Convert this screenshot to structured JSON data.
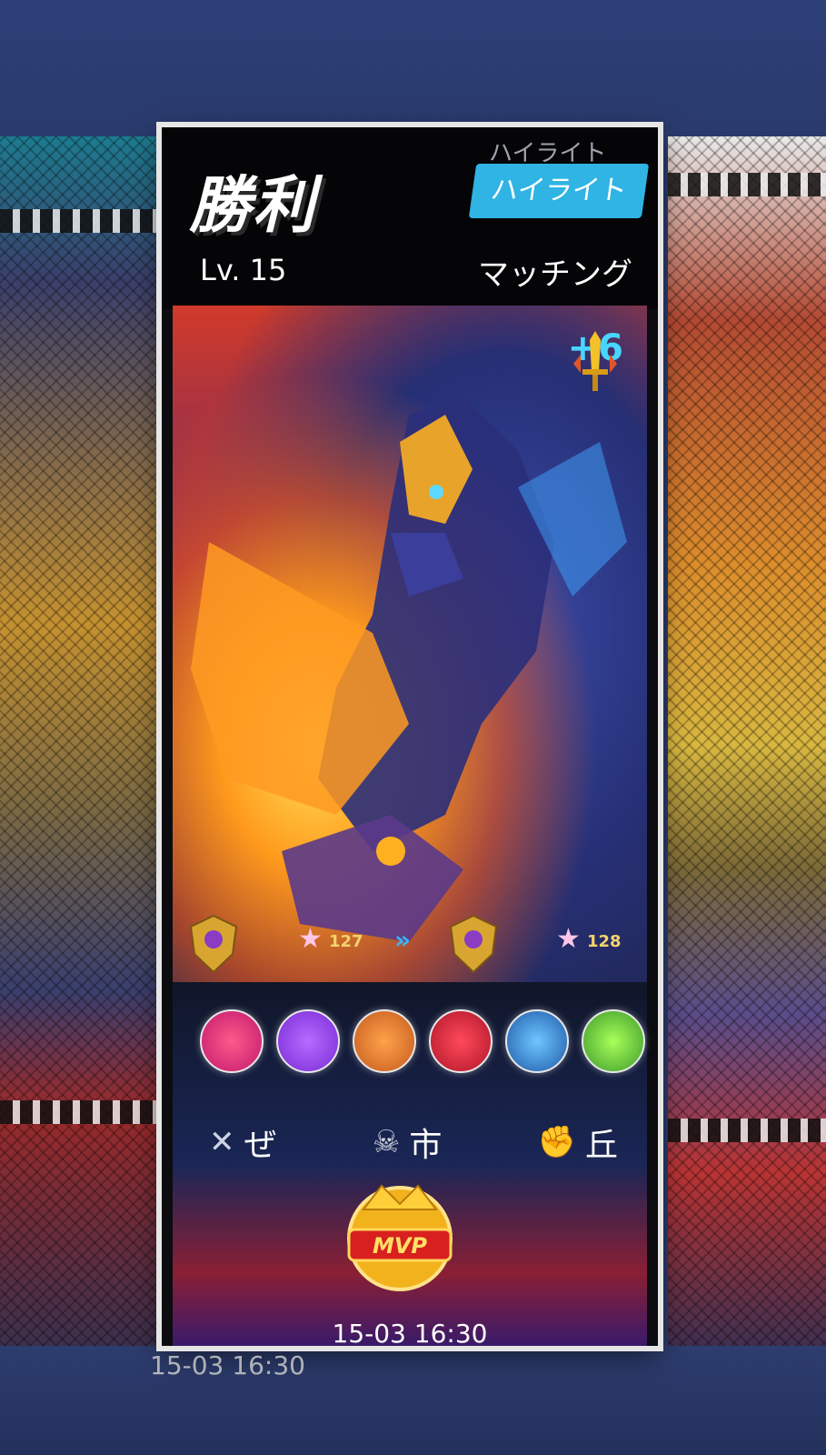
{
  "header": {
    "title": "勝利",
    "highlight_label": "ハイライト",
    "level": "Lv. 15",
    "mode": "マッチング"
  },
  "boost": {
    "value": "+6"
  },
  "rank": {
    "before_stars": "127",
    "after_stars": "128"
  },
  "items": [
    {
      "name": "item-1",
      "color": "#c2186e"
    },
    {
      "name": "item-2",
      "color": "#7b2bd6"
    },
    {
      "name": "item-3",
      "color": "#c45a1e"
    },
    {
      "name": "item-4",
      "color": "#b0152a"
    },
    {
      "name": "item-5",
      "color": "#1f5aa8"
    },
    {
      "name": "item-6",
      "color": "#3d9a2a"
    }
  ],
  "kda": {
    "kills": "ぜ",
    "deaths": "市",
    "assists": "丘"
  },
  "badge": {
    "label": "MVP"
  },
  "footer": {
    "date": "15-03 16:30",
    "date_ghost": "15-03 16:30"
  }
}
